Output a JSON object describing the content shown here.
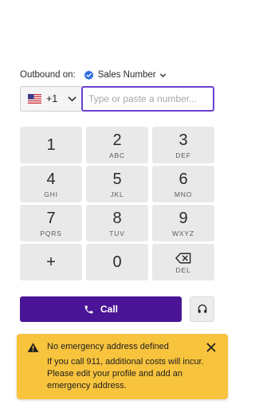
{
  "outbound": {
    "label": "Outbound on:",
    "selected_number": "Sales Number",
    "verified_icon": "check-badge-icon",
    "accent_color": "#2d6cdf"
  },
  "phone": {
    "country_code": "+1",
    "country_flag": "us-flag-icon",
    "placeholder": "Type or paste a number...",
    "value": ""
  },
  "keypad": {
    "keys": [
      {
        "digit": "1",
        "letters": ""
      },
      {
        "digit": "2",
        "letters": "ABC"
      },
      {
        "digit": "3",
        "letters": "DEF"
      },
      {
        "digit": "4",
        "letters": "GHI"
      },
      {
        "digit": "5",
        "letters": "JKL"
      },
      {
        "digit": "6",
        "letters": "MNO"
      },
      {
        "digit": "7",
        "letters": "PQRS"
      },
      {
        "digit": "8",
        "letters": "TUV"
      },
      {
        "digit": "9",
        "letters": "WXYZ"
      },
      {
        "digit": "+",
        "letters": ""
      },
      {
        "digit": "0",
        "letters": ""
      },
      {
        "digit": "",
        "letters": "DEL",
        "icon": "backspace-icon"
      }
    ]
  },
  "actions": {
    "call_label": "Call",
    "call_color": "#4a1596",
    "call_icon": "phone-icon",
    "headset_icon": "headset-icon"
  },
  "alert": {
    "title": "No emergency address defined",
    "body": "If you call 911, additional costs will incur. Please edit your profile and add an emergency address.",
    "background": "#f8c33d",
    "icon": "warning-icon",
    "close_icon": "close-icon"
  }
}
